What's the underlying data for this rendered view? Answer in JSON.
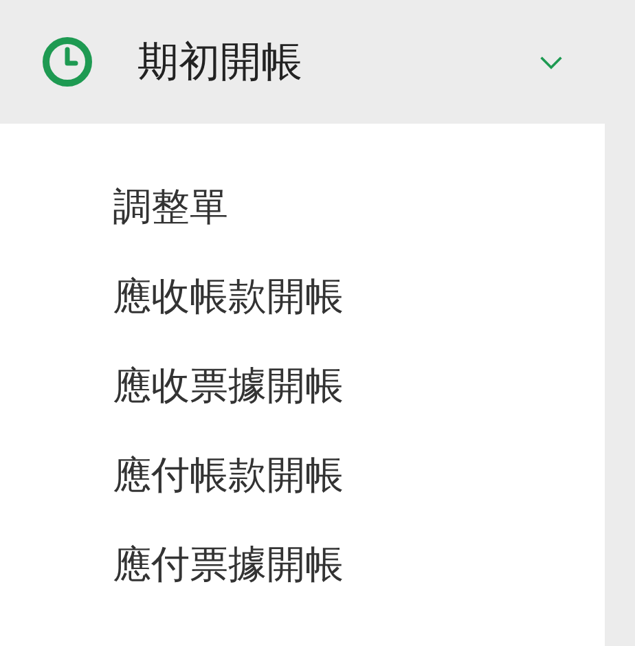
{
  "menu_group": {
    "title": "期初開帳",
    "expanded": true,
    "items": [
      {
        "label": "調整單"
      },
      {
        "label": "應收帳款開帳"
      },
      {
        "label": "應收票據開帳"
      },
      {
        "label": "應付帳款開帳"
      },
      {
        "label": "應付票據開帳"
      }
    ]
  }
}
